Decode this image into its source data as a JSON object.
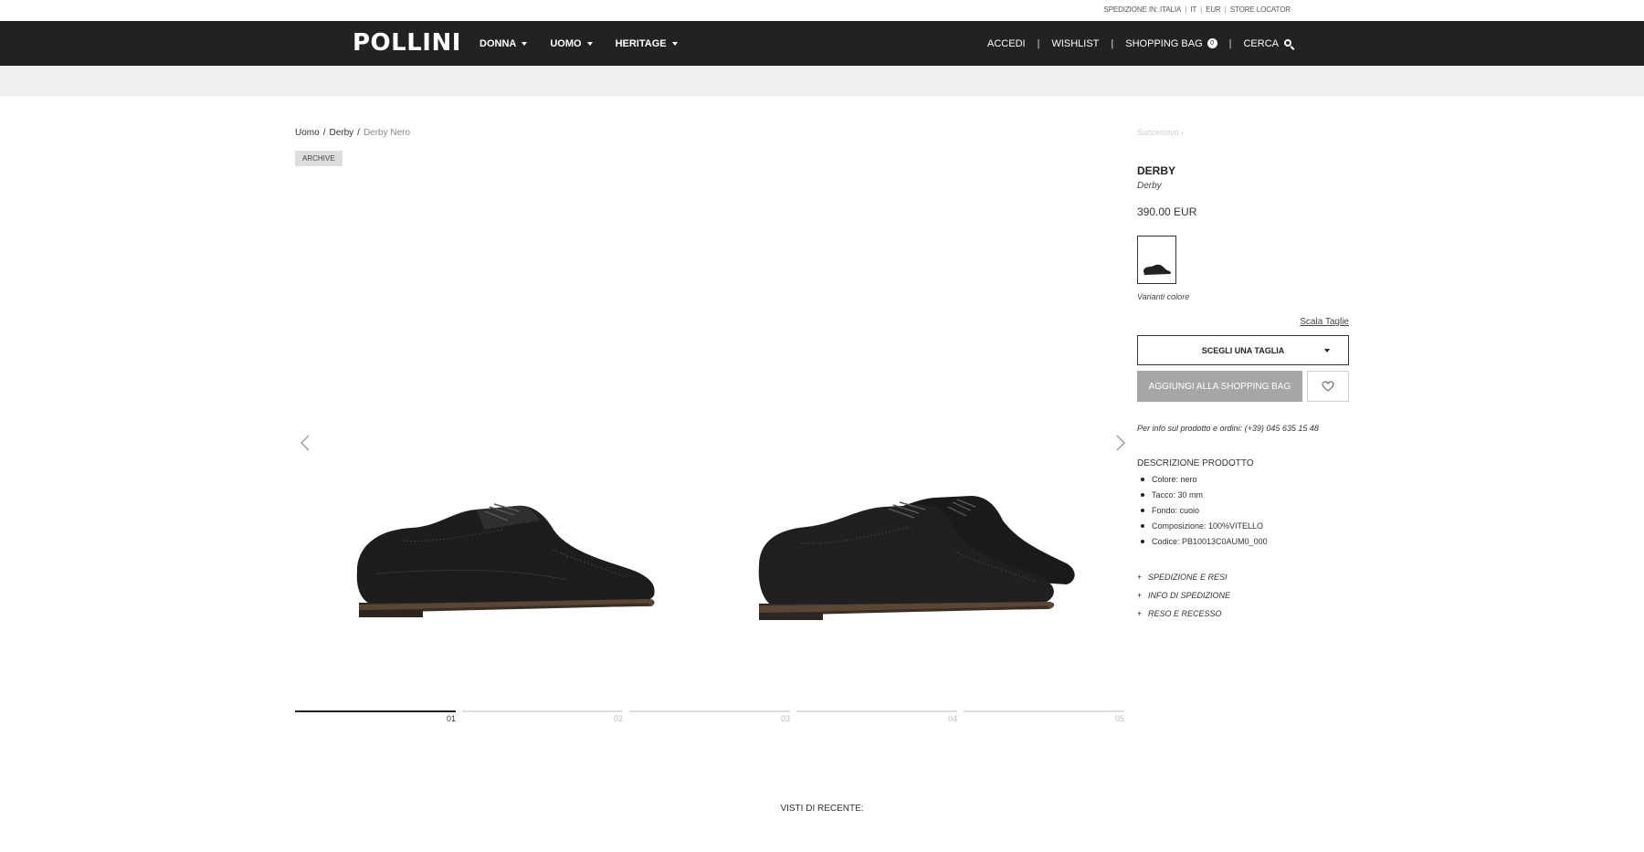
{
  "utility": {
    "shipping": "SPEDIZIONE IN: ITALIA",
    "language": "IT",
    "currency": "EUR",
    "store_locator": "STORE LOCATOR"
  },
  "nav": {
    "logo": "POLLINI",
    "menu": [
      "DONNA",
      "UOMO",
      "HERITAGE"
    ],
    "login": "ACCEDI",
    "wishlist": "WISHLIST",
    "bag": "SHOPPING BAG",
    "bag_count": "0",
    "search": "CERCA"
  },
  "breadcrumb": [
    "Uomo",
    "Derby",
    "Derby Nero"
  ],
  "badge": "ARCHIVE",
  "gallery": {
    "pages": [
      "01",
      "02",
      "03",
      "04",
      "05"
    ],
    "active_page": 1
  },
  "product": {
    "next": "Successivo",
    "title": "DERBY",
    "subtitle": "Derby",
    "price": "390.00 EUR",
    "color_variants_label": "Varianti colore",
    "size_guide": "Scala Taglie",
    "size_select": "SCEGLI UNA TAGLIA",
    "add_to_bag": "AGGIUNGI ALLA SHOPPING BAG",
    "phone_info": "Per info sul prodotto e ordini: (+39) 045 635 15 48",
    "description_title": "DESCRIZIONE PRODOTTO",
    "description": [
      "Colore: nero",
      "Tacco: 30 mm",
      "Fondo: cuoio",
      "Composizione: 100%VITELLO",
      "Codice: PB10013C0AUM0_000"
    ],
    "accordions": [
      "SPEDIZIONE E RESI",
      "INFO DI SPEDIZIONE",
      "RESO E RECESSO"
    ]
  },
  "recent": "VISTI DI RECENTE:",
  "colors": {
    "nav_bg": "#222222",
    "band_bg": "#efefef",
    "add_bag_bg": "#a6a6a6"
  }
}
